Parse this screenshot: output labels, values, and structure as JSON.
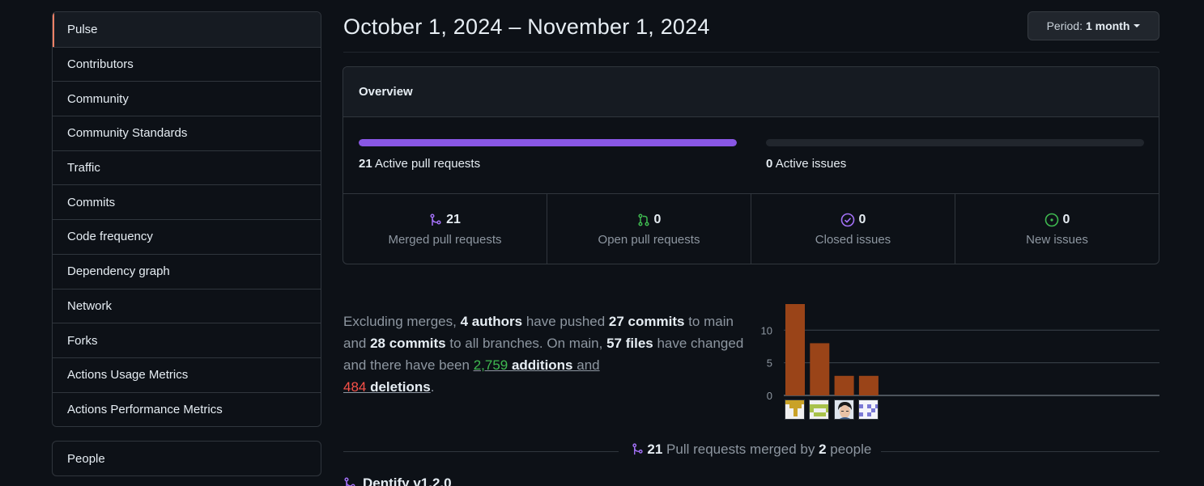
{
  "sidebar": {
    "items": [
      {
        "label": "Pulse"
      },
      {
        "label": "Contributors"
      },
      {
        "label": "Community"
      },
      {
        "label": "Community Standards"
      },
      {
        "label": "Traffic"
      },
      {
        "label": "Commits"
      },
      {
        "label": "Code frequency"
      },
      {
        "label": "Dependency graph"
      },
      {
        "label": "Network"
      },
      {
        "label": "Forks"
      },
      {
        "label": "Actions Usage Metrics"
      },
      {
        "label": "Actions Performance Metrics"
      }
    ],
    "secondary": [
      {
        "label": "People"
      }
    ]
  },
  "header": {
    "title": "October 1, 2024 – November 1, 2024",
    "period_prefix": "Period:",
    "period_value": "1 month"
  },
  "overview": {
    "title": "Overview",
    "pull_requests": {
      "count": "21",
      "label": "Active pull requests",
      "fill": 1.0
    },
    "issues": {
      "count": "0",
      "label": "Active issues",
      "fill": 0.0
    },
    "stats": [
      {
        "value": "21",
        "label": "Merged pull requests",
        "icon": "git-merge-icon",
        "color": "#a371f7"
      },
      {
        "value": "0",
        "label": "Open pull requests",
        "icon": "git-pull-request-icon",
        "color": "#3fb950"
      },
      {
        "value": "0",
        "label": "Closed issues",
        "icon": "issue-closed-icon",
        "color": "#a371f7"
      },
      {
        "value": "0",
        "label": "New issues",
        "icon": "issue-opened-icon",
        "color": "#3fb950"
      }
    ]
  },
  "summary": {
    "t1": "Excluding merges, ",
    "authors": "4 authors",
    "t2": " have pushed ",
    "commits_main": "27 commits",
    "t3": " to main and ",
    "commits_all": "28 commits",
    "t4": " to all branches. On main, ",
    "files": "57 files",
    "t5": " have changed and there have been ",
    "additions_num": "2,759",
    "additions_word": " additions",
    "t6": " and",
    "deletions_num": "484",
    "deletions_word": " deletions",
    "t7": "."
  },
  "chart_data": {
    "type": "bar",
    "categories": [
      "author-1",
      "author-2",
      "author-3",
      "author-4"
    ],
    "values": [
      14,
      8,
      3,
      3
    ],
    "ylim": [
      0,
      14
    ],
    "yticks": [
      0,
      5,
      10
    ],
    "bar_color": "#9a4418",
    "grid": true
  },
  "merged": {
    "count": "21",
    "t1": " Pull requests merged by ",
    "people": "2",
    "t2": " people"
  },
  "pr_list": [
    {
      "title": "Dentify v1.2.0"
    }
  ]
}
